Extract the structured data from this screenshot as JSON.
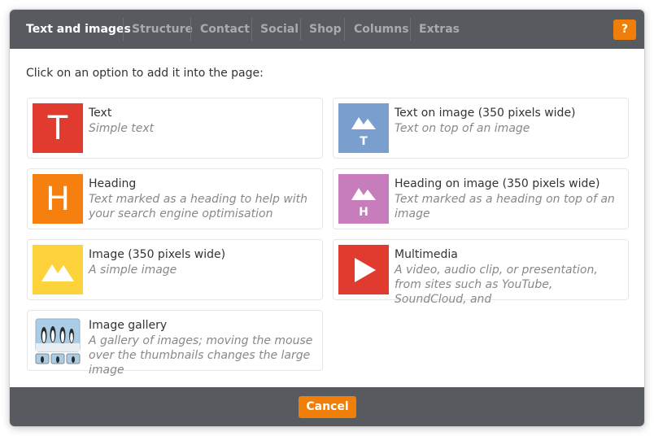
{
  "tabs": [
    {
      "label": "Text and images",
      "active": true
    },
    {
      "label": "Structure",
      "active": false
    },
    {
      "label": "Contact",
      "active": false
    },
    {
      "label": "Social",
      "active": false
    },
    {
      "label": "Shop",
      "active": false
    },
    {
      "label": "Columns",
      "active": false
    },
    {
      "label": "Extras",
      "active": false
    }
  ],
  "help_label": "?",
  "instruction": "Click on an option to add it into the page:",
  "options": [
    {
      "title": "Text",
      "desc": "Simple text",
      "icon": "letter-t-icon",
      "glyph": "T",
      "color": "#e03b2e"
    },
    {
      "title": "Text on image (350 pixels wide)",
      "desc": "Text on top of an image",
      "icon": "text-on-image-icon",
      "glyph": "T",
      "color": "#7a9fce"
    },
    {
      "title": "Heading",
      "desc": "Text marked as a heading to help with your search engine optimisation",
      "icon": "letter-h-icon",
      "glyph": "H",
      "color": "#f57f0f"
    },
    {
      "title": "Heading on image (350 pixels wide)",
      "desc": "Text marked as a heading on top of an image",
      "icon": "heading-on-image-icon",
      "glyph": "H",
      "color": "#c77dbb"
    },
    {
      "title": "Image (350 pixels wide)",
      "desc": "A simple image",
      "icon": "image-icon",
      "glyph": "",
      "color": "#fdd23a"
    },
    {
      "title": "Multimedia",
      "desc": "A video, audio clip, or presentation, from sites such as YouTube, SoundCloud, and",
      "icon": "play-icon",
      "glyph": "",
      "color": "#e03b2e"
    },
    {
      "title": "Image gallery",
      "desc": "A gallery of images; moving the mouse over the thumbnails changes the large image",
      "icon": "gallery-icon",
      "glyph": "",
      "color": "#a9cde6"
    }
  ],
  "cancel_label": "Cancel"
}
